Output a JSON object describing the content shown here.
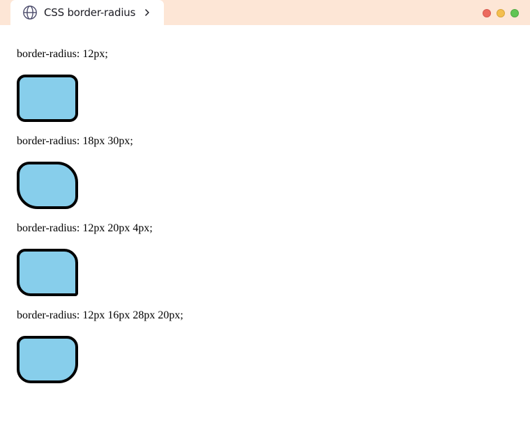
{
  "browser": {
    "tab_title": "CSS border-radius",
    "tab_icon": "globe-icon",
    "window_controls": [
      "close",
      "minimize",
      "maximize"
    ],
    "colors": {
      "titlebar_bg": "#fde6d6",
      "close": "#ec6a5e",
      "minimize": "#f4bf4f",
      "maximize": "#61c554"
    }
  },
  "demos": [
    {
      "label": "border-radius: 12px;"
    },
    {
      "label": "border-radius: 18px 30px;"
    },
    {
      "label": "border-radius: 12px 20px 4px;"
    },
    {
      "label": "border-radius: 12px 16px 28px 20px;"
    }
  ],
  "colors": {
    "box_fill": "#87ceeb",
    "box_border": "#000000"
  }
}
